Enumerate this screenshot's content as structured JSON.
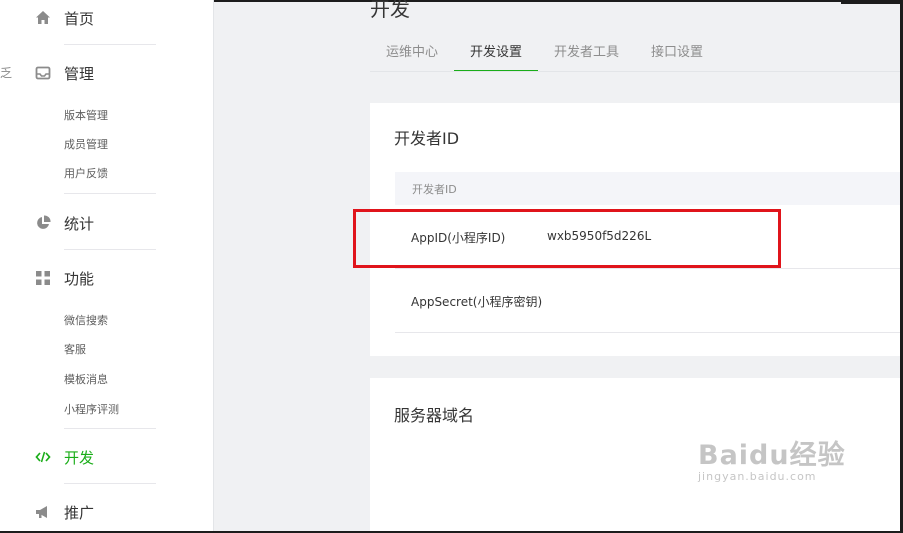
{
  "sidebar": {
    "stub_char": "乏",
    "home": "首页",
    "manage": {
      "label": "管理",
      "items": [
        "版本管理",
        "成员管理",
        "用户反馈"
      ]
    },
    "stats": "统计",
    "features": {
      "label": "功能",
      "items": [
        "微信搜索",
        "客服",
        "模板消息",
        "小程序评测"
      ]
    },
    "develop": "开发",
    "promote": "推广"
  },
  "main": {
    "title": "开发",
    "tabs": [
      {
        "label": "运维中心",
        "active": false
      },
      {
        "label": "开发设置",
        "active": true
      },
      {
        "label": "开发者工具",
        "active": false
      },
      {
        "label": "接口设置",
        "active": false
      }
    ],
    "developer_id_card": {
      "title": "开发者ID",
      "table_header": "开发者ID",
      "rows": [
        {
          "key": "AppID(小程序ID)",
          "value": "wxb5950f5d226L"
        },
        {
          "key": "AppSecret(小程序密钥)",
          "value": ""
        }
      ]
    },
    "server_domain_card": {
      "title": "服务器域名"
    }
  },
  "watermark": {
    "logo": "Baidu经验",
    "url": "jingyan.baidu.com"
  },
  "colors": {
    "accent": "#1aad19",
    "highlight": "#e0141b",
    "sidebar_bg": "#ffffff",
    "page_bg": "#f0f1f3"
  },
  "icons": {
    "home": "home-icon",
    "manage": "inbox-icon",
    "stats": "pie-chart-icon",
    "features": "grid-icon",
    "develop": "code-icon",
    "promote": "megaphone-icon"
  }
}
